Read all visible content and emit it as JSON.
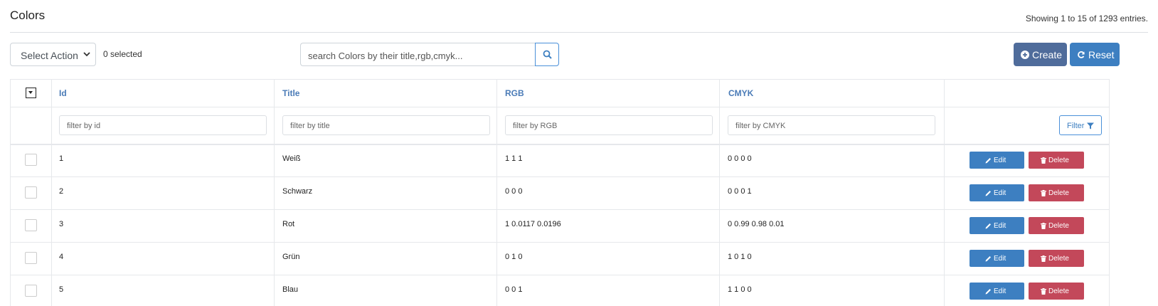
{
  "header": {
    "title": "Colors",
    "entries_info": "Showing 1 to 15 of 1293 entries."
  },
  "toolbar": {
    "select_action": "Select Action",
    "selected_count": "0 selected",
    "search_placeholder": "search Colors by their title,rgb,cmyk...",
    "create_label": "Create",
    "reset_label": "Reset"
  },
  "table": {
    "columns": [
      "Id",
      "Title",
      "RGB",
      "CMYK"
    ],
    "filters": [
      "filter by id",
      "filter by title",
      "filter by RGB",
      "filter by CMYK"
    ],
    "filter_button": "Filter",
    "edit_label": "Edit",
    "delete_label": "Delete",
    "rows": [
      {
        "id": "1",
        "title": "Weiß",
        "rgb": "1 1 1",
        "cmyk": "0 0 0 0"
      },
      {
        "id": "2",
        "title": "Schwarz",
        "rgb": "0 0 0",
        "cmyk": "0 0 0 1"
      },
      {
        "id": "3",
        "title": "Rot",
        "rgb": "1 0.0117 0.0196",
        "cmyk": "0 0.99 0.98 0.01"
      },
      {
        "id": "4",
        "title": "Grün",
        "rgb": "0 1 0",
        "cmyk": "1 0 1 0"
      },
      {
        "id": "5",
        "title": "Blau",
        "rgb": "0 0 1",
        "cmyk": "1 1 0 0"
      }
    ]
  },
  "colors": {
    "primary": "#3d7fc1",
    "create": "#4f6c9b",
    "danger": "#c3485a",
    "header_link": "#4a7bb7"
  },
  "icons": {
    "select_chevron": "chevron-down-icon",
    "search": "search-icon",
    "create": "plus-circle-icon",
    "reset": "refresh-icon",
    "filter": "filter-icon",
    "edit": "pencil-icon",
    "delete": "trash-icon"
  }
}
